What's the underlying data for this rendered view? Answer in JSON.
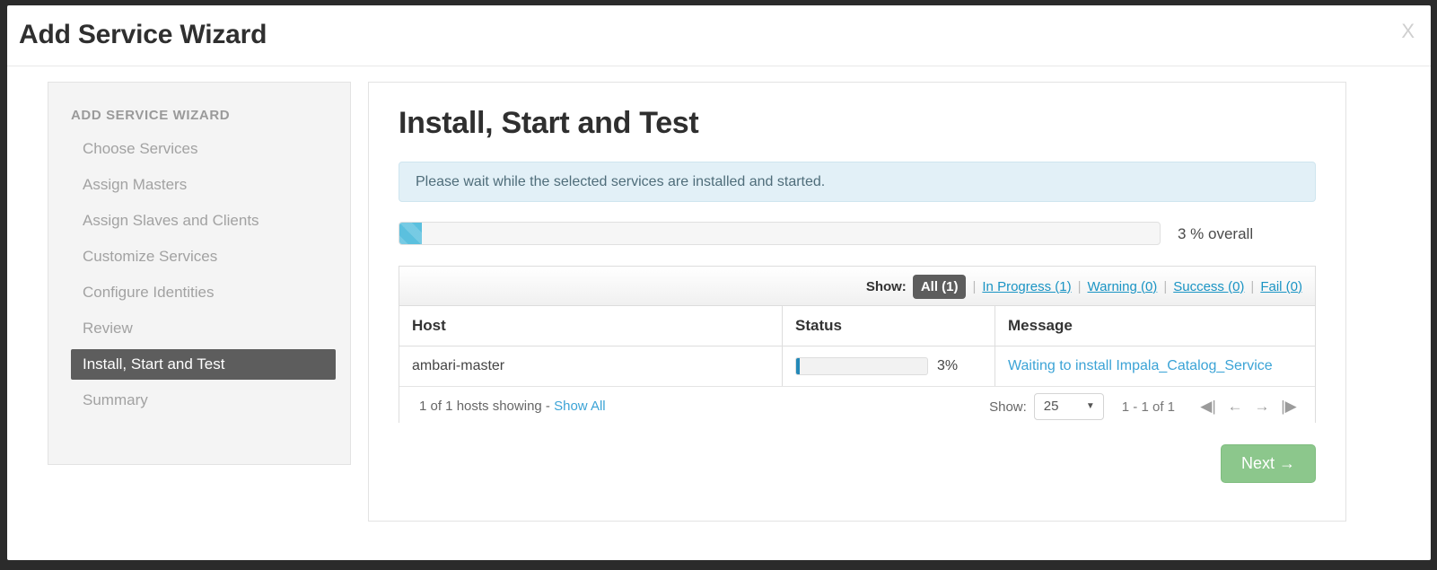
{
  "window": {
    "title": "Add Service Wizard",
    "close_label": "X"
  },
  "sidebar": {
    "heading": "ADD SERVICE WIZARD",
    "items": [
      {
        "label": "Choose Services",
        "active": false
      },
      {
        "label": "Assign Masters",
        "active": false
      },
      {
        "label": "Assign Slaves and Clients",
        "active": false
      },
      {
        "label": "Customize Services",
        "active": false
      },
      {
        "label": "Configure Identities",
        "active": false
      },
      {
        "label": "Review",
        "active": false
      },
      {
        "label": "Install, Start and Test",
        "active": true
      },
      {
        "label": "Summary",
        "active": false
      }
    ]
  },
  "main": {
    "page_title": "Install, Start and Test",
    "alert_message": "Please wait while the selected services are installed and started.",
    "overall_progress": {
      "percent": 3,
      "label": "3 % overall"
    },
    "filter": {
      "show_label": "Show:",
      "active": "All (1)",
      "options": [
        {
          "label": "In Progress (1)"
        },
        {
          "label": "Warning (0)"
        },
        {
          "label": "Success (0)"
        },
        {
          "label": "Fail (0)"
        }
      ],
      "separator": "|"
    },
    "table": {
      "columns": [
        "Host",
        "Status",
        "Message"
      ],
      "rows": [
        {
          "host": "ambari-master",
          "status_percent": 3,
          "status_label": "3%",
          "message": "Waiting to install Impala_Catalog_Service"
        }
      ]
    },
    "footer": {
      "hosts_showing": "1 of 1 hosts showing -",
      "show_all_label": "Show All",
      "show_label": "Show:",
      "page_size": "25",
      "caret": "▼",
      "range": "1 - 1 of 1",
      "pager": {
        "first": "◀|",
        "prev": "←",
        "next": "→",
        "last": "|▶"
      }
    },
    "next_button": "Next →"
  },
  "colors": {
    "accent_blue": "#3ba3d6",
    "progress_blue": "#5bc0de",
    "row_progress_blue": "#2489b8",
    "active_nav": "#5d5d5d",
    "next_green": "#8cc78c",
    "alert_bg": "#e2f0f7"
  }
}
